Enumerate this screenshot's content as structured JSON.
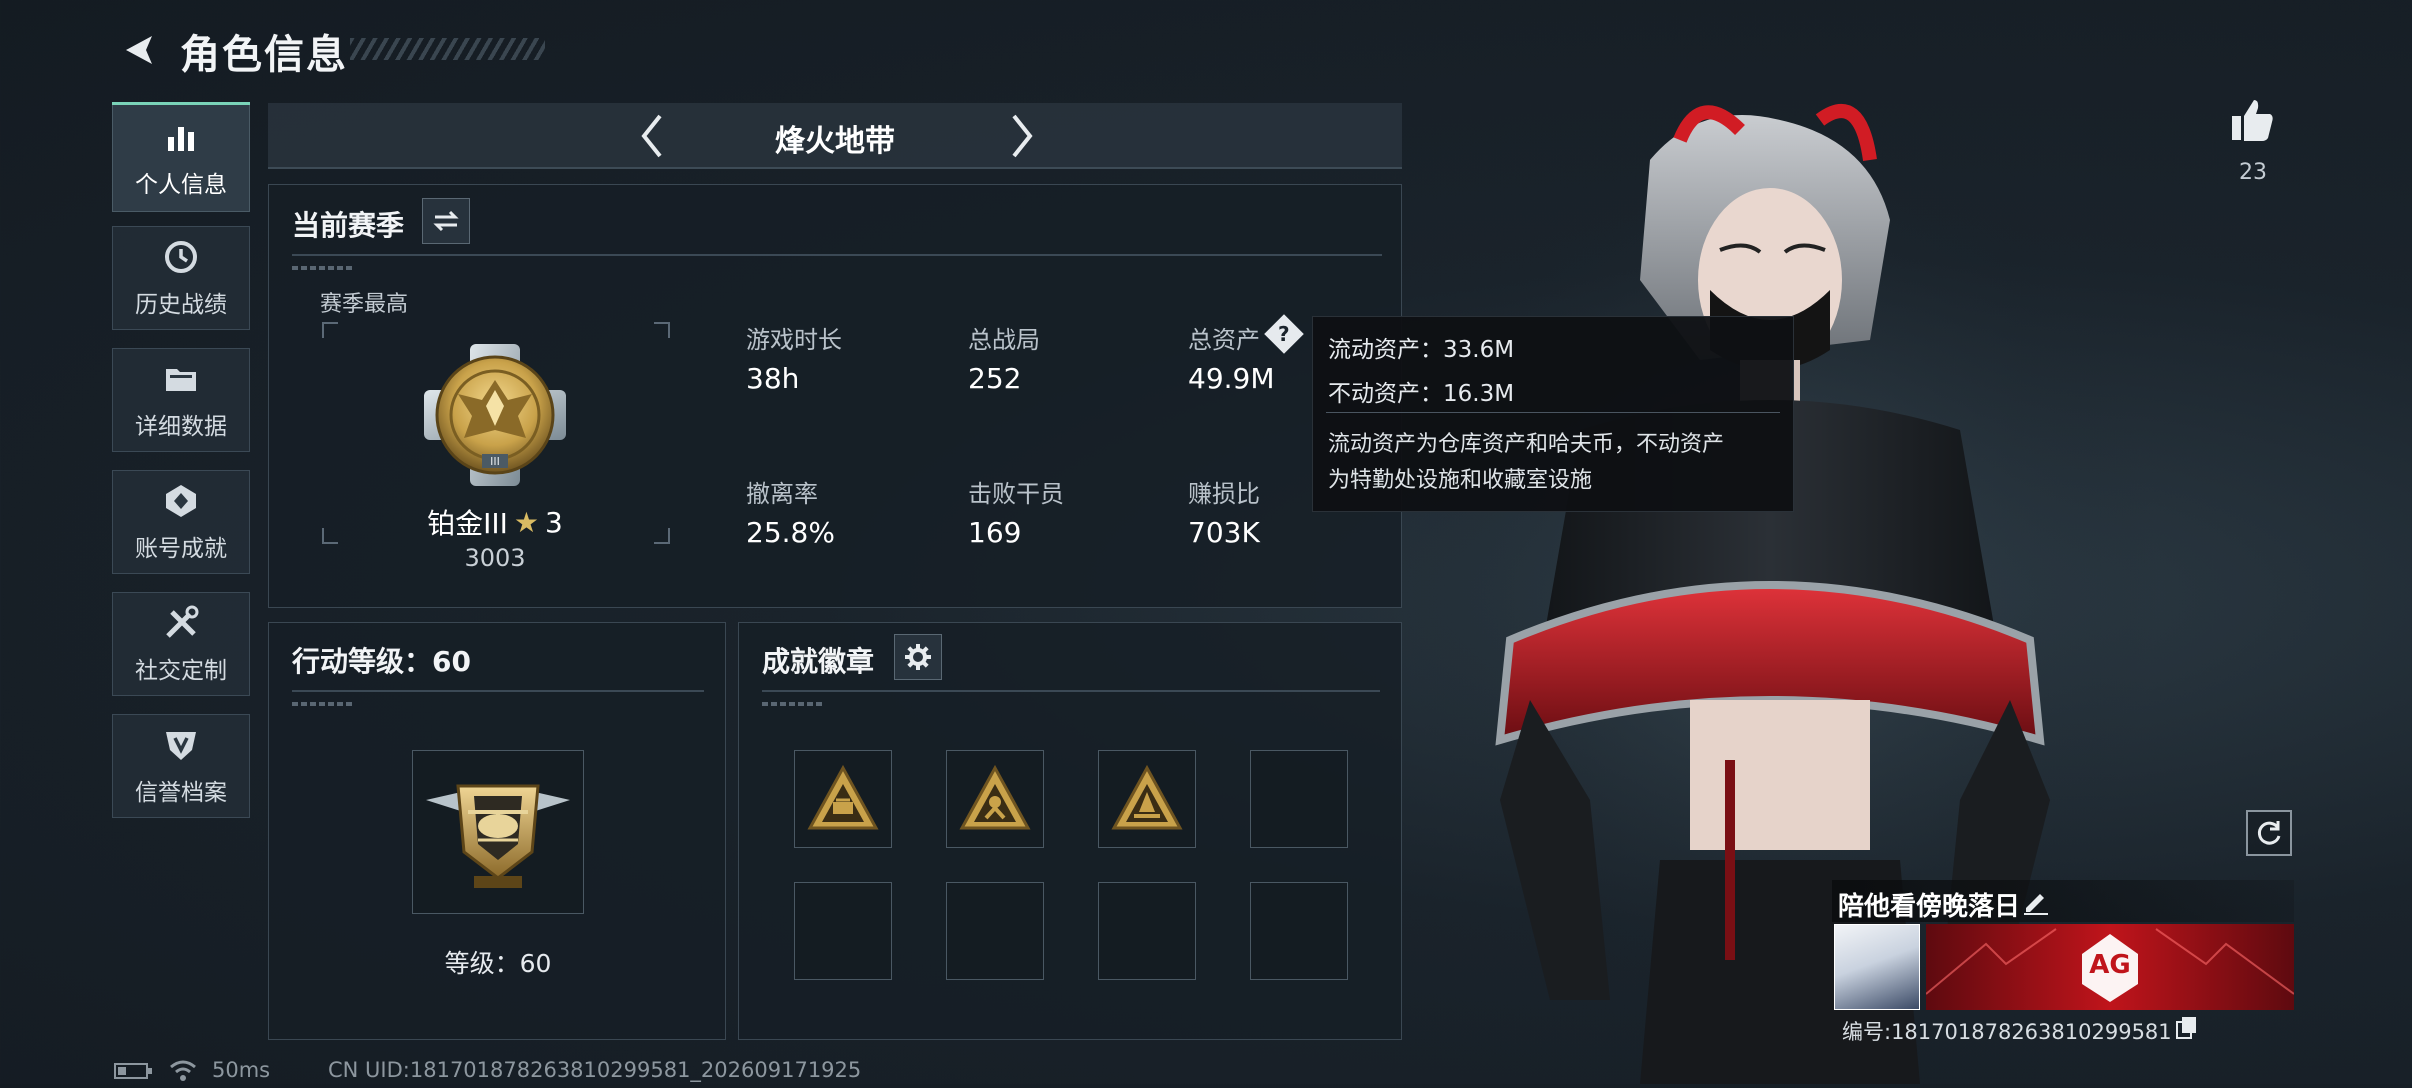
{
  "header": {
    "title": "角色信息"
  },
  "sidebar": {
    "items": [
      {
        "label": "个人信息",
        "icon": "bar-chart-icon",
        "active": true
      },
      {
        "label": "历史战绩",
        "icon": "history-icon",
        "active": false
      },
      {
        "label": "详细数据",
        "icon": "folder-icon",
        "active": false
      },
      {
        "label": "账号成就",
        "icon": "achievement-icon",
        "active": false
      },
      {
        "label": "社交定制",
        "icon": "tools-icon",
        "active": false
      },
      {
        "label": "信誉档案",
        "icon": "shield-icon",
        "active": false
      }
    ]
  },
  "mode_selector": {
    "current": "烽火地带"
  },
  "season": {
    "title": "当前赛季",
    "highest_label": "赛季最高",
    "rank_name": "铂金III",
    "rank_stars": "3",
    "rank_score": "3003",
    "stats": [
      {
        "label": "游戏时长",
        "value": "38h"
      },
      {
        "label": "总战局",
        "value": "252"
      },
      {
        "label": "总资产",
        "value": "49.9M"
      },
      {
        "label": "撤离率",
        "value": "25.8%"
      },
      {
        "label": "击败干员",
        "value": "169"
      },
      {
        "label": "赚损比",
        "value": "703K"
      }
    ]
  },
  "tooltip": {
    "line1": "流动资产：33.6M",
    "line2": "不动资产：16.3M",
    "desc1": "流动资产为仓库资产和哈夫币，不动资产",
    "desc2": "为特勤处设施和收藏室设施"
  },
  "action_level": {
    "title": "行动等级：60",
    "level_text": "等级：60"
  },
  "badges": {
    "title": "成就徽章",
    "slots": [
      true,
      true,
      true,
      false,
      false,
      false,
      false,
      false
    ]
  },
  "likes": {
    "count": "23"
  },
  "player": {
    "name": "陪他看傍晚落日",
    "id_text": "编号:181701878263810299581",
    "card_text": "AG"
  },
  "status": {
    "ping": "50ms",
    "uid": "CN UID:181701878263810299581_202609171925"
  },
  "colors": {
    "accent": "#7ad3b8",
    "card_red": "#c0141b",
    "gold": "#c9a24a"
  }
}
